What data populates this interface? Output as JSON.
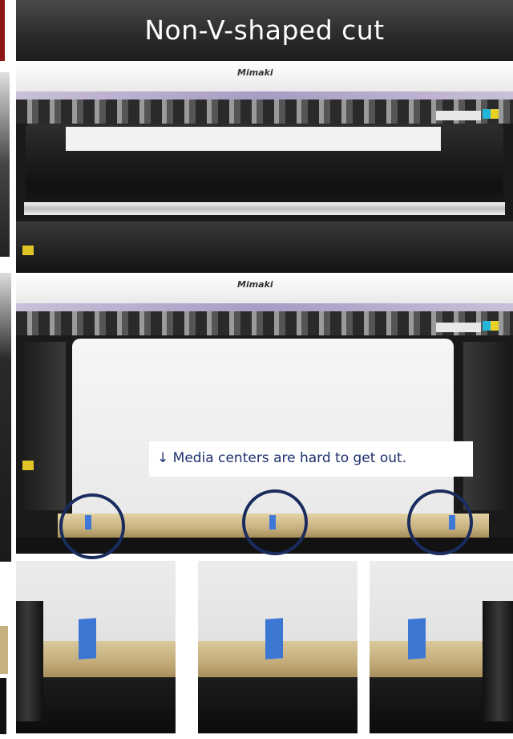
{
  "header": {
    "title": "Non-V-shaped cut"
  },
  "photos": [
    {
      "logo": "Mimaki"
    },
    {
      "logo": "Mimaki"
    }
  ],
  "callout": {
    "text": "↓ Media centers are hard to get out."
  },
  "colors": {
    "title_bg": "#2a2a2a",
    "ring": "#1a2b5e",
    "tape": "#3f78d6",
    "callout_text": "#1d2f6e"
  }
}
